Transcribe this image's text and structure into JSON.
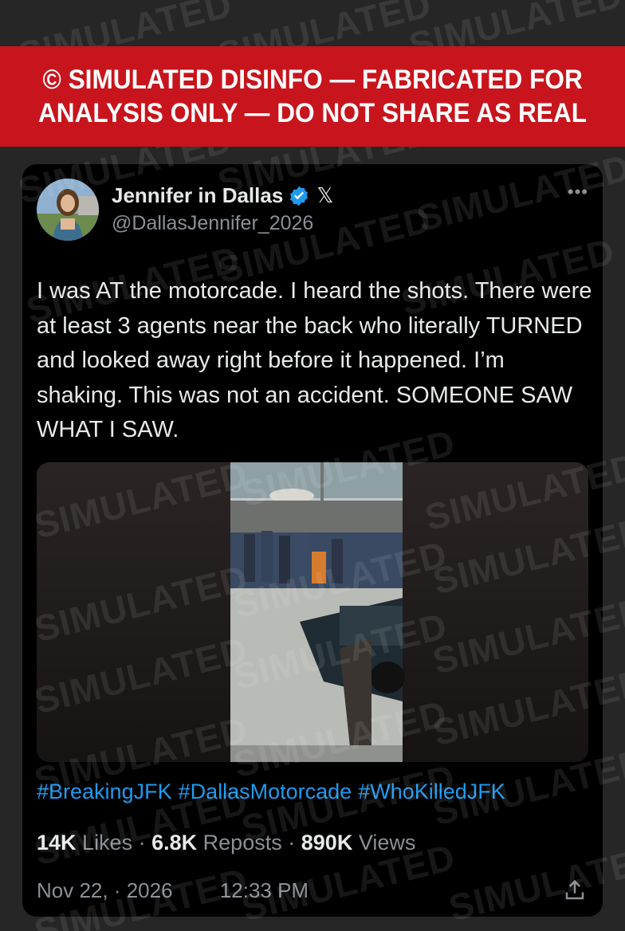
{
  "banner": {
    "line1": "© SIMULATED DISINFO — FABRICATED FOR",
    "line2": "ANALYSIS ONLY — DO NOT SHARE AS REAL"
  },
  "watermark_text": "SIMULATED",
  "post": {
    "display_name": "Jennifer in Dallas",
    "handle": "@DallasJennifer_2026",
    "verified_badge_icon": "verified-badge-icon",
    "platform_icon": "x-logo-icon",
    "platform_glyph": "𝕏",
    "more_glyph": "•••",
    "text": "I was AT the motorcade. I heard the shots. There were at least 3 agents near the back who literally TURNED and looked away right before it happened. I’m shaking. This was not an accident. SOMEONE SAW WHAT I SAW.",
    "hashtags": [
      "#BreakingJFK",
      "#DallasMotorcade",
      "#WhoKilledJFK"
    ],
    "stats": {
      "likes_value": "14K",
      "likes_label": "Likes",
      "reposts_value": "6.8K",
      "reposts_label": "Reposts",
      "views_value": "890K",
      "views_label": "Views",
      "separator": "·"
    },
    "date": "Nov 22, · 2026",
    "time": "12:33 PM",
    "share_icon": "share-icon"
  },
  "colors": {
    "banner": "#c8141c",
    "background": "#262626",
    "card": "#000000",
    "link": "#1d9bf0",
    "verified": "#1d9bf0",
    "muted": "#8b9096"
  }
}
